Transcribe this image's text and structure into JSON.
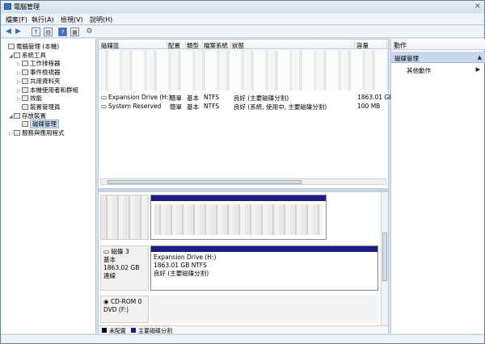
{
  "window": {
    "title": "電腦管理",
    "close_glyph": "×"
  },
  "menu": [
    "檔案(F)",
    "執行(A)",
    "檢視(V)",
    "說明(H)"
  ],
  "toolbar_icons": [
    "back-icon",
    "forward-icon",
    "up-folder-icon",
    "show-tree-icon",
    "help-icon",
    "properties-icon",
    "console-icon"
  ],
  "tree": [
    {
      "label": "電腦管理 (本機)",
      "icon": "computer-icon",
      "level": 0,
      "tw": ""
    },
    {
      "label": "系統工具",
      "icon": "tools-icon",
      "level": 1,
      "tw": "◢"
    },
    {
      "label": "工作排程器",
      "icon": "clock-icon",
      "level": 2,
      "tw": "▷"
    },
    {
      "label": "事件檢視器",
      "icon": "event-viewer-icon",
      "level": 2,
      "tw": "▷"
    },
    {
      "label": "共用資料夾",
      "icon": "shared-folder-icon",
      "level": 2,
      "tw": "▷"
    },
    {
      "label": "本機使用者和群組",
      "icon": "users-icon",
      "level": 2,
      "tw": "▷"
    },
    {
      "label": "效能",
      "icon": "performance-icon",
      "level": 2,
      "tw": "▷"
    },
    {
      "label": "裝置管理員",
      "icon": "device-manager-icon",
      "level": 2,
      "tw": ""
    },
    {
      "label": "存放裝置",
      "icon": "storage-icon",
      "level": 1,
      "tw": "◢"
    },
    {
      "label": "磁碟管理",
      "icon": "disk-management-icon",
      "level": 2,
      "tw": "",
      "selected": true
    },
    {
      "label": "服務與應用程式",
      "icon": "services-icon",
      "level": 1,
      "tw": "▷"
    }
  ],
  "columns": [
    "磁碟區",
    "配置",
    "類型",
    "檔案系統",
    "狀態",
    "容量"
  ],
  "volumes": [
    {
      "name": "Expansion Drive (H:)",
      "layout": "簡單",
      "type": "基本",
      "fs": "NTFS",
      "status": "良好 (主要磁碟分割)",
      "capacity": "1863.01 GB"
    },
    {
      "name": "System Reserved",
      "layout": "簡單",
      "type": "基本",
      "fs": "NTFS",
      "status": "良好 (系統, 使用中, 主要磁碟分割)",
      "capacity": "100 MB"
    }
  ],
  "disk3": {
    "name": "磁碟 3",
    "type": "基本",
    "size": "1863.02 GB",
    "state": "連線",
    "partition_name": "Expansion Drive  (H:)",
    "partition_size": "1863.01 GB NTFS",
    "partition_status": "良好 (主要磁碟分割)"
  },
  "cdrom": {
    "name": "CD-ROM 0",
    "drive": "DVD (F:)"
  },
  "legend": {
    "unallocated": "未配置",
    "primary": "主要磁碟分割",
    "unallocated_color": "#000000",
    "primary_color": "#1c1c82"
  },
  "actions": {
    "header": "動作",
    "section": "磁碟管理",
    "more": "其他動作"
  }
}
